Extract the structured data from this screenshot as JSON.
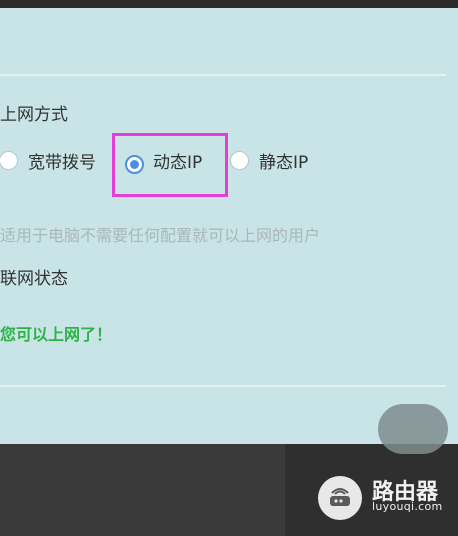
{
  "form": {
    "connection_section_title": "上网方式",
    "connection_options": [
      {
        "label": "宽带拨号",
        "selected": false
      },
      {
        "label": "动态IP",
        "selected": true
      },
      {
        "label": "静态IP",
        "selected": false
      }
    ],
    "hint_text": "适用于电脑不需要任何配置就可以上网的用户",
    "status_section_title": "联网状态",
    "status_text": "您可以上网了！"
  },
  "watermark": {
    "title": "路由器",
    "subtitle": "luyouqi.com"
  },
  "colors": {
    "panel_bg": "#c9e4e6",
    "highlight_border": "#e63dd6",
    "radio_selected": "#4a90e2",
    "status_green": "#2fb24a"
  },
  "icons": {
    "watermark_logo": "router-logo-icon"
  }
}
